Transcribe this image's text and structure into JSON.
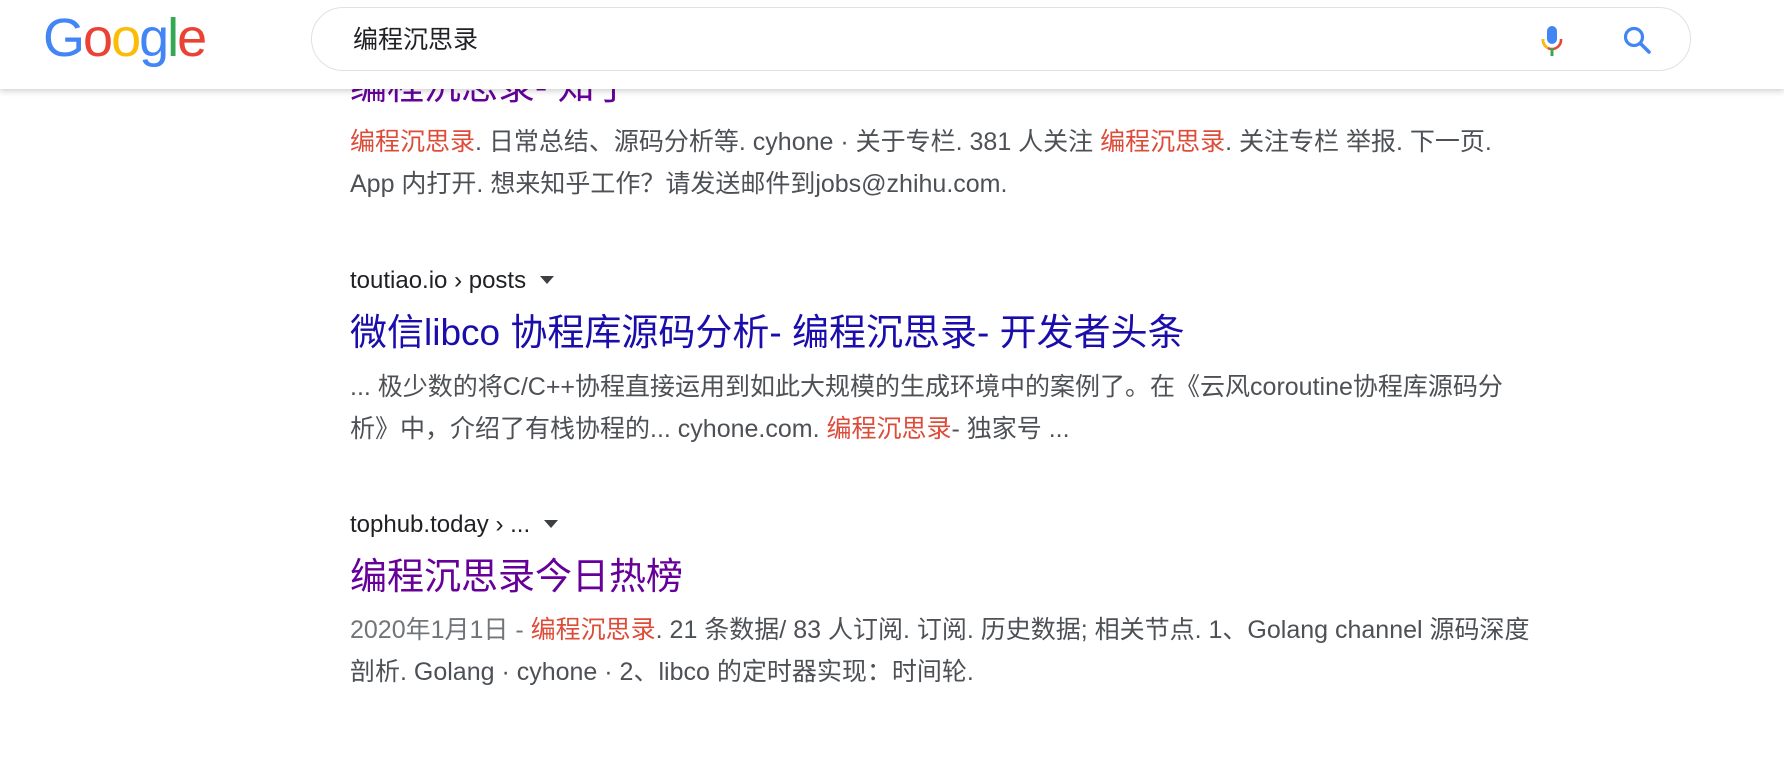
{
  "colors": {
    "logo_blue": "#4285F4",
    "logo_red": "#EA4335",
    "logo_yellow": "#FBBC05",
    "logo_green": "#34A853",
    "title_link": "#1a0dab",
    "title_visited": "#660099",
    "highlight": "#dd4b39",
    "snippet_text": "#4d5156"
  },
  "header": {
    "logo": {
      "letters": [
        "G",
        "o",
        "o",
        "g",
        "l",
        "e"
      ],
      "letter_colors": [
        "#4285F4",
        "#EA4335",
        "#FBBC05",
        "#4285F4",
        "#34A853",
        "#EA4335"
      ]
    },
    "query": "编程沉思录",
    "icons": {
      "mic": "microphone-icon",
      "search": "search-icon"
    }
  },
  "results": [
    {
      "title": "编程沉思录- 知乎",
      "visited": true,
      "snippet": [
        {
          "t": "编程沉思录",
          "hl": true
        },
        {
          "t": ". 日常总结、源码分析等. cyhone · 关于专栏. 381 人关注 "
        },
        {
          "t": "编程沉思录",
          "hl": true
        },
        {
          "t": ". 关注专栏 举报. 下一页. App 内打开. 想来知乎工作？请发送邮件到jobs@zhihu.com."
        }
      ]
    },
    {
      "url": "toutiao.io › posts",
      "title": "微信libco 协程库源码分析- 编程沉思录- 开发者头条",
      "visited": false,
      "snippet": [
        {
          "t": "... 极少数的将C/C++协程直接运用到如此大规模的生成环境中的案例了。在《云风coroutine协程库源码分析》中，介绍了有栈协程的... cyhone.com. "
        },
        {
          "t": "编程沉思录",
          "hl": true
        },
        {
          "t": "- 独家号 ..."
        }
      ]
    },
    {
      "url": "tophub.today › ...",
      "title": "编程沉思录今日热榜",
      "visited": true,
      "date": "2020年1月1日 - ",
      "snippet": [
        {
          "t": "编程沉思录",
          "hl": true
        },
        {
          "t": ". 21 条数据/ 83 人订阅. 订阅. 历史数据; 相关节点. 1、Golang channel 源码深度剖析. Golang · cyhone · 2、libco 的定时器实现：时间轮."
        }
      ]
    }
  ]
}
